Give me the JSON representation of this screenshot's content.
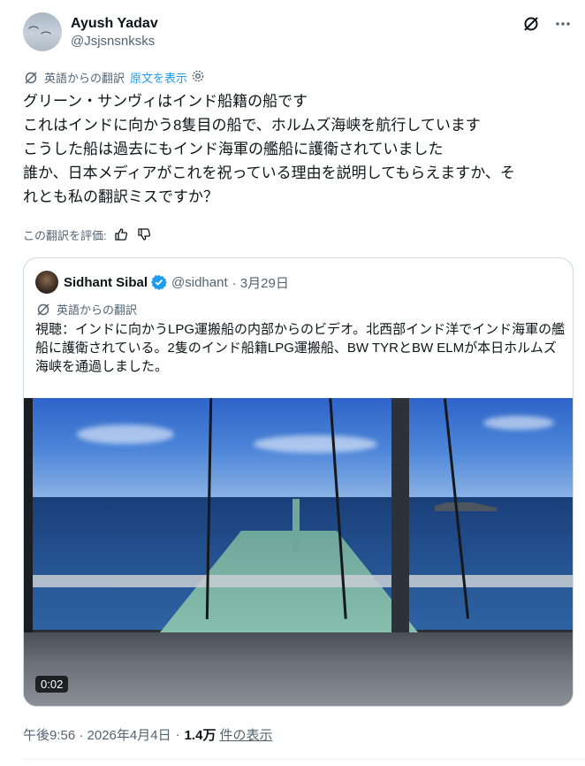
{
  "post": {
    "author_name": "Ayush Yadav",
    "author_handle": "@Jsjsnsnksks",
    "translated_from": "英語からの翻訳",
    "show_original": "原文を表示",
    "text_lines": [
      "グリーン・サンヴィはインド船籍の船です",
      "これはインドに向かう8隻目の船で、ホルムズ海峡を航行しています",
      "こうした船は過去にもインド海軍の艦船に護衛されていました",
      "誰か、日本メディアがこれを祝っている理由を説明してもらえますか、そ",
      "れとも私の翻訳ミスですか？"
    ],
    "rate_translation": "この翻訳を評価:"
  },
  "quote": {
    "name": "Sidhant Sibal",
    "handle": "@sidhant",
    "date": "· 3月29日",
    "translated_from": "英語からの翻訳",
    "text": "視聴：インドに向かうLPG運搬船の内部からのビデオ。北西部インド洋でインド海軍の艦船に護衛されている。2隻のインド船籍LPG運搬船、BW TYRとBW ELMが本日ホルムズ海峡を通過しました。",
    "video_duration": "0:02"
  },
  "meta": {
    "time": "午後9:56 · 2026年4月4日",
    "sep": "·",
    "views": "1.4万",
    "views_label": "件の表示"
  },
  "colors": {
    "accent": "#1d9bf0",
    "verified": "#1d9bf0",
    "text": "#0f1419",
    "muted": "#536471"
  }
}
